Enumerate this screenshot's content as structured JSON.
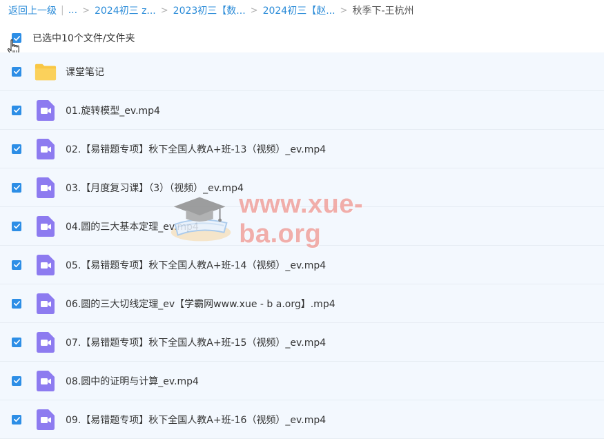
{
  "breadcrumb": {
    "back_label": "返回上一级",
    "ellipsis": "...",
    "items": [
      "2024初三 z...",
      "2023初三【数...",
      "2024初三【赵..."
    ],
    "current": "秋季下-王杭州"
  },
  "selection": {
    "checked": true,
    "text": "已选中10个文件/文件夹"
  },
  "files": [
    {
      "name": "课堂笔记",
      "type": "folder",
      "checked": true
    },
    {
      "name": "01.旋转模型_ev.mp4",
      "type": "video",
      "checked": true
    },
    {
      "name": "02.【易错题专项】秋下全国人教A+班-13（视频）_ev.mp4",
      "type": "video",
      "checked": true
    },
    {
      "name": "03.【月度复习课】（3）（视频）_ev.mp4",
      "type": "video",
      "checked": true
    },
    {
      "name": "04.圆的三大基本定理_ev.mp4",
      "type": "video",
      "checked": true
    },
    {
      "name": "05.【易错题专项】秋下全国人教A+班-14（视频）_ev.mp4",
      "type": "video",
      "checked": true
    },
    {
      "name": "06.圆的三大切线定理_ev【学霸网www.xue - b a.org】.mp4",
      "type": "video",
      "checked": true
    },
    {
      "name": "07.【易错题专项】秋下全国人教A+班-15（视频）_ev.mp4",
      "type": "video",
      "checked": true
    },
    {
      "name": "08.圆中的证明与计算_ev.mp4",
      "type": "video",
      "checked": true
    },
    {
      "name": "09.【易错题专项】秋下全国人教A+班-16（视频）_ev.mp4",
      "type": "video",
      "checked": true
    }
  ],
  "watermark": {
    "text": "www.xue-ba.org"
  },
  "colors": {
    "accent": "#2d8ee6",
    "link": "#2a8bd8",
    "row_bg": "#f3f8fe",
    "video_icon": "#8d7bf0",
    "folder_icon": "#f9c744"
  },
  "icons": {
    "video": "video-camera-icon",
    "folder": "folder-icon",
    "check": "checkmark-icon",
    "cursor": "hand-pointer-icon"
  }
}
